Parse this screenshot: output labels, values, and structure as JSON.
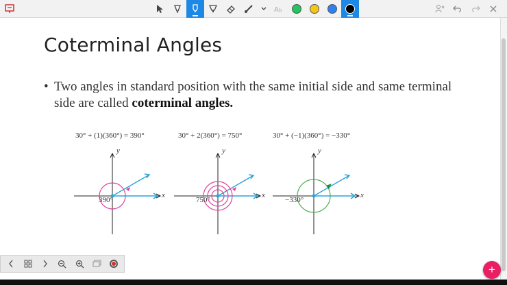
{
  "toolbar": {
    "left_icon": "presentation-icon",
    "tools": [
      {
        "name": "pointer",
        "icon": "cursor-icon",
        "active": false
      },
      {
        "name": "pen",
        "icon": "pen-icon",
        "active": false
      },
      {
        "name": "marker",
        "icon": "marker-icon",
        "active": true
      },
      {
        "name": "highlighter",
        "icon": "highlighter-icon",
        "active": false
      },
      {
        "name": "eraser",
        "icon": "eraser-icon",
        "active": false
      },
      {
        "name": "brush",
        "icon": "brush-icon",
        "active": false
      },
      {
        "name": "more",
        "icon": "chevron-down-icon",
        "active": false
      },
      {
        "name": "text",
        "icon": "text-icon",
        "active": false
      }
    ],
    "colors": [
      "#22c55e",
      "#f5c518",
      "#2f80ed",
      "#000000"
    ],
    "selected_color": "#000000",
    "right_icons": [
      "people-icon",
      "undo-icon",
      "redo-icon",
      "close-icon"
    ]
  },
  "slide": {
    "title": "Coterminal Angles",
    "bullet_dot": "•",
    "bullet_plain": "Two angles in standard position with the same initial side and same terminal side are called ",
    "bullet_bold": "coterminal angles."
  },
  "diagrams": [
    {
      "equation": "30° + (1)(360°) = 390°",
      "angle_label": "390°",
      "x_label": "x",
      "y_label": "y",
      "color": "#e0419a"
    },
    {
      "equation": "30° + 2(360°) = 750°",
      "angle_label": "750°",
      "x_label": "x",
      "y_label": "y",
      "color": "#e0419a"
    },
    {
      "equation": "30° + (−1)(360°) = −330°",
      "angle_label": "−330°",
      "x_label": "x",
      "y_label": "y",
      "color": "#4caf50"
    }
  ],
  "bottom_bar": {
    "icons": [
      "chevron-left-icon",
      "grid-icon",
      "chevron-right-icon",
      "zoom-out-icon",
      "zoom-in-icon",
      "screen-icon",
      "record-icon"
    ]
  },
  "fab": {
    "label": "+"
  },
  "accent": "#1e88e5"
}
